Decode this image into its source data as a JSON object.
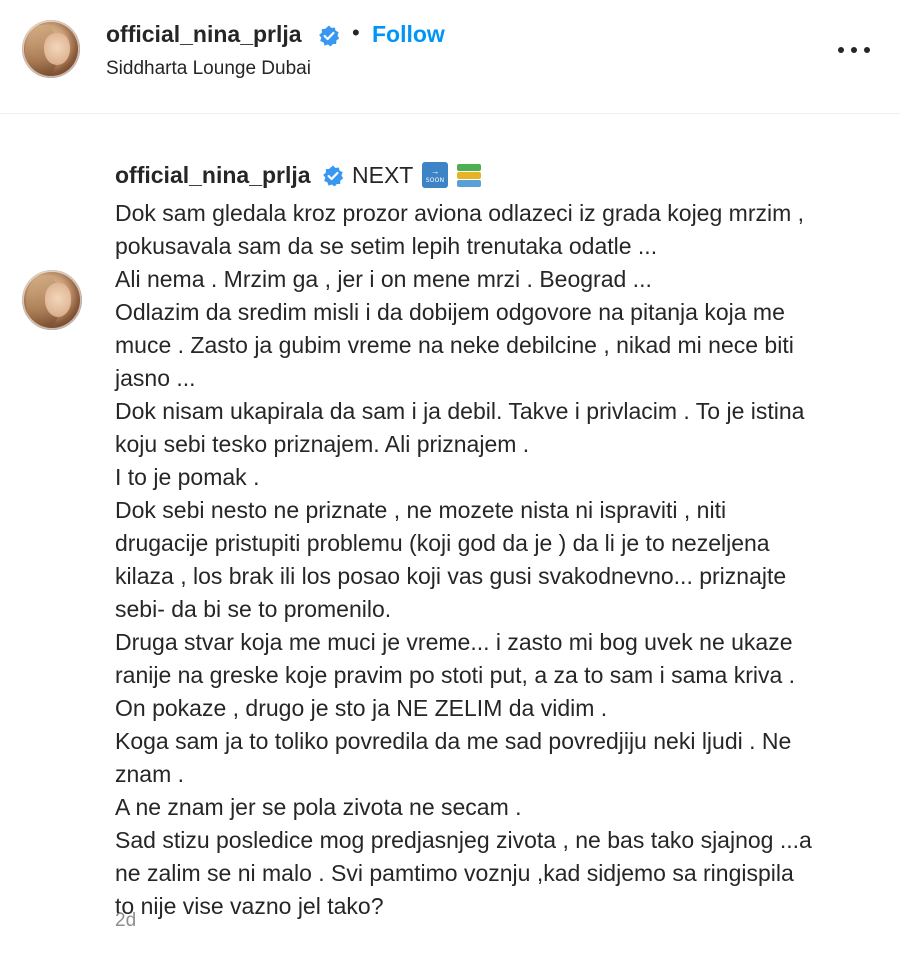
{
  "header": {
    "username": "official_nina_prlja",
    "separator": "•",
    "follow_label": "Follow",
    "location": "Siddharta Lounge Dubai"
  },
  "post": {
    "username": "official_nina_prlja",
    "next_label": "NEXT",
    "soon_emoji_arrow": "→",
    "soon_emoji_text": "SOON",
    "caption_lines": [
      "Dok sam gledala kroz prozor aviona odlazeci iz grada kojeg mrzim ,",
      "pokusavala sam da se setim lepih trenutaka odatle ...",
      "Ali nema . Mrzim ga , jer i on mene mrzi . Beograd ...",
      "Odlazim da sredim misli i da dobijem odgovore na pitanja koja me",
      "muce . Zasto ja gubim vreme na neke debilcine , nikad mi nece biti",
      "jasno ...",
      "Dok nisam ukapirala da sam i ja debil. Takve i privlacim . To je istina",
      "koju sebi tesko priznajem. Ali priznajem .",
      "I to je pomak .",
      "Dok sebi nesto ne priznate , ne mozete nista ni ispraviti , niti",
      "drugacije pristupiti problemu (koji god da je ) da li je to nezeljena",
      "kilaza , los brak ili los posao koji vas gusi svakodnevno... priznajte",
      "sebi- da bi se to promenilo.",
      "Druga stvar koja me muci je vreme... i zasto mi bog uvek ne ukaze",
      "ranije na greske koje pravim po stoti put, a za to sam i sama kriva .",
      "On pokaze , drugo je sto ja NE ZELIM da vidim .",
      "Koga sam ja to toliko povredila da me sad povredjiju neki ljudi . Ne",
      "znam .",
      "A ne znam jer se pola zivota ne secam .",
      "Sad stizu posledice mog predjasnjeg zivota , ne bas tako sjajnog ...a",
      "ne zalim se ni malo . Svi pamtimo voznju ,kad sidjemo sa ringispila",
      "to nije vise vazno jel tako?"
    ],
    "timestamp": "2d"
  },
  "icons": {
    "verified": "verified-badge-icon",
    "more": "more-options-icon",
    "soon": "soon-arrow-emoji",
    "books": "books-emoji"
  },
  "colors": {
    "link_blue": "#0095f6",
    "verified_blue": "#3897f0",
    "text": "#262626",
    "muted": "#8e8e8e"
  }
}
